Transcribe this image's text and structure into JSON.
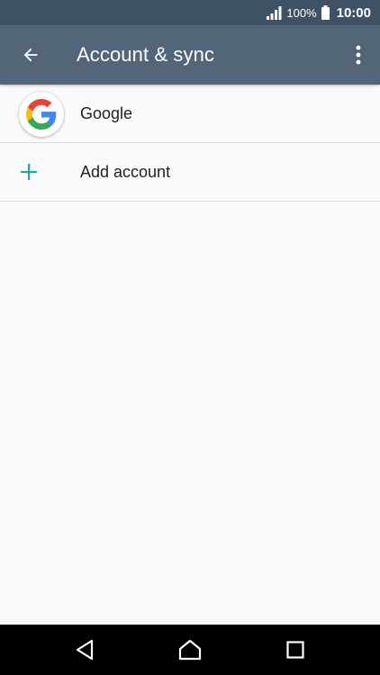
{
  "status_bar": {
    "battery_percent": "100%",
    "time": "10:00",
    "icons": [
      "signal-icon",
      "battery-icon"
    ]
  },
  "app_bar": {
    "title": "Account & sync",
    "back_icon": "arrow-back-icon",
    "menu_icon": "more-vert-icon"
  },
  "accounts": {
    "items": [
      {
        "label": "Google",
        "icon": "google-logo"
      },
      {
        "label": "Add account",
        "icon": "plus-icon"
      }
    ]
  },
  "colors": {
    "status_bar": "#3f5165",
    "app_bar": "#526579",
    "accent": "#26a69a",
    "background": "#fafafa"
  },
  "nav_bar": {
    "icons": [
      "back-triangle-icon",
      "home-icon",
      "recents-icon"
    ]
  }
}
